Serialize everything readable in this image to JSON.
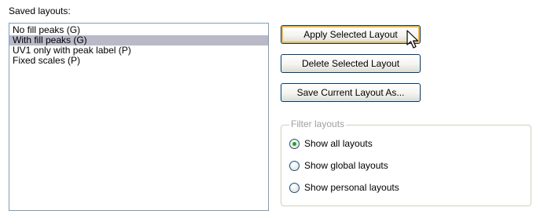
{
  "saved_layouts": {
    "label": "Saved layouts:",
    "items": [
      {
        "label": "No fill peaks (G)",
        "selected": false
      },
      {
        "label": "With fill peaks (G)",
        "selected": true
      },
      {
        "label": "UV1 only with peak label (P)",
        "selected": false
      },
      {
        "label": "Fixed scales (P)",
        "selected": false
      }
    ]
  },
  "buttons": {
    "apply": "Apply Selected Layout",
    "delete": "Delete Selected Layout",
    "save": "Save Current Layout As..."
  },
  "filter": {
    "legend": "Filter layouts",
    "options": [
      {
        "label": "Show all layouts",
        "checked": true
      },
      {
        "label": "Show global layouts",
        "checked": false
      },
      {
        "label": "Show personal layouts",
        "checked": false
      }
    ]
  },
  "colors": {
    "selection": "#b9b9c8",
    "hot_border": "#f8b33c",
    "radio_dot": "#21a121"
  }
}
